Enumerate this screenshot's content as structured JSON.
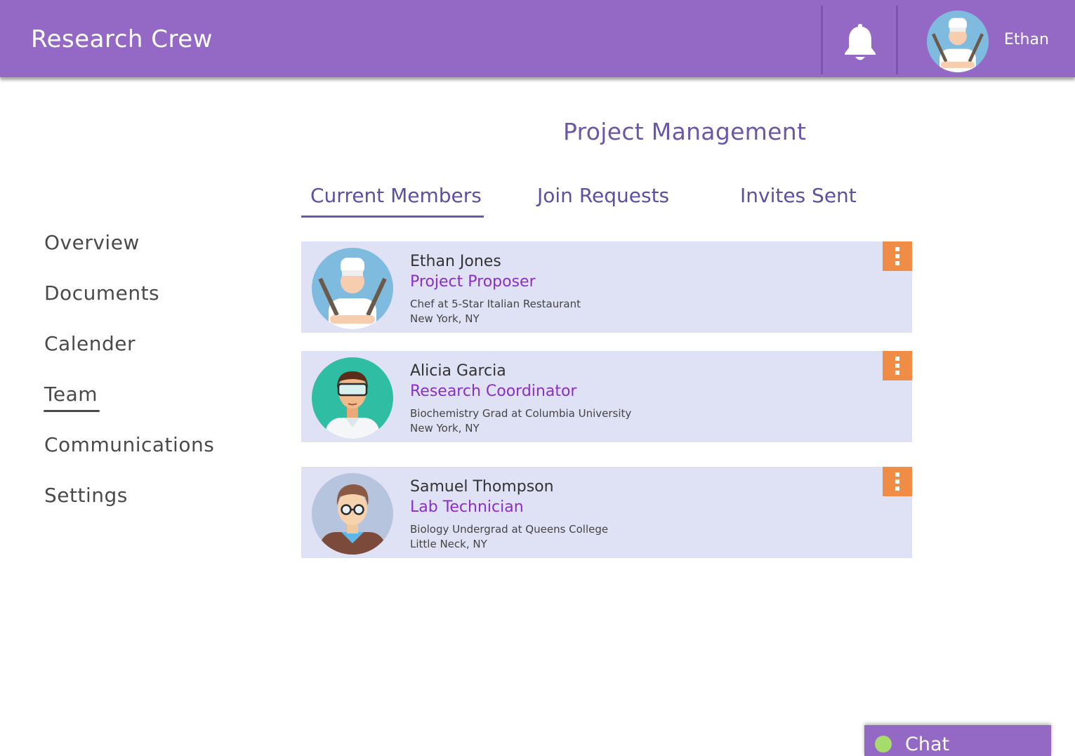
{
  "app": {
    "title": "Research Crew"
  },
  "header": {
    "user_name": "Ethan"
  },
  "page": {
    "title": "Project Management"
  },
  "tabs": [
    {
      "label": "Current Members",
      "active": true
    },
    {
      "label": "Join Requests",
      "active": false
    },
    {
      "label": "Invites Sent",
      "active": false
    }
  ],
  "sidebar": {
    "items": [
      {
        "label": "Overview",
        "active": false
      },
      {
        "label": "Documents",
        "active": false
      },
      {
        "label": "Calender",
        "active": false
      },
      {
        "label": "Team",
        "active": true
      },
      {
        "label": "Communications",
        "active": false
      },
      {
        "label": "Settings",
        "active": false
      }
    ]
  },
  "members": [
    {
      "name": "Ethan Jones",
      "role": "Project Proposer",
      "description": "Chef at 5-Star Italian Restaurant",
      "location": "New York, NY",
      "avatar": "chef-avatar"
    },
    {
      "name": "Alicia Garcia",
      "role": "Research Coordinator",
      "description": "Biochemistry Grad at Columbia University",
      "location": "New York, NY",
      "avatar": "goggles-avatar"
    },
    {
      "name": "Samuel Thompson",
      "role": "Lab Technician",
      "description": "Biology Undergrad at Queens College",
      "location": "Little Neck, NY",
      "avatar": "glasses-avatar"
    }
  ],
  "chat": {
    "label": "Chat",
    "status": "online"
  },
  "icons": {
    "notifications": "bell-icon",
    "member_menu": "more-vertical-icon",
    "chat_status": "status-dot-icon"
  },
  "colors": {
    "header": "#9469c6",
    "card": "#dfe1f5",
    "role": "#8a2fc6",
    "menu_button": "#ef8c46",
    "online": "#a6dc6c"
  }
}
